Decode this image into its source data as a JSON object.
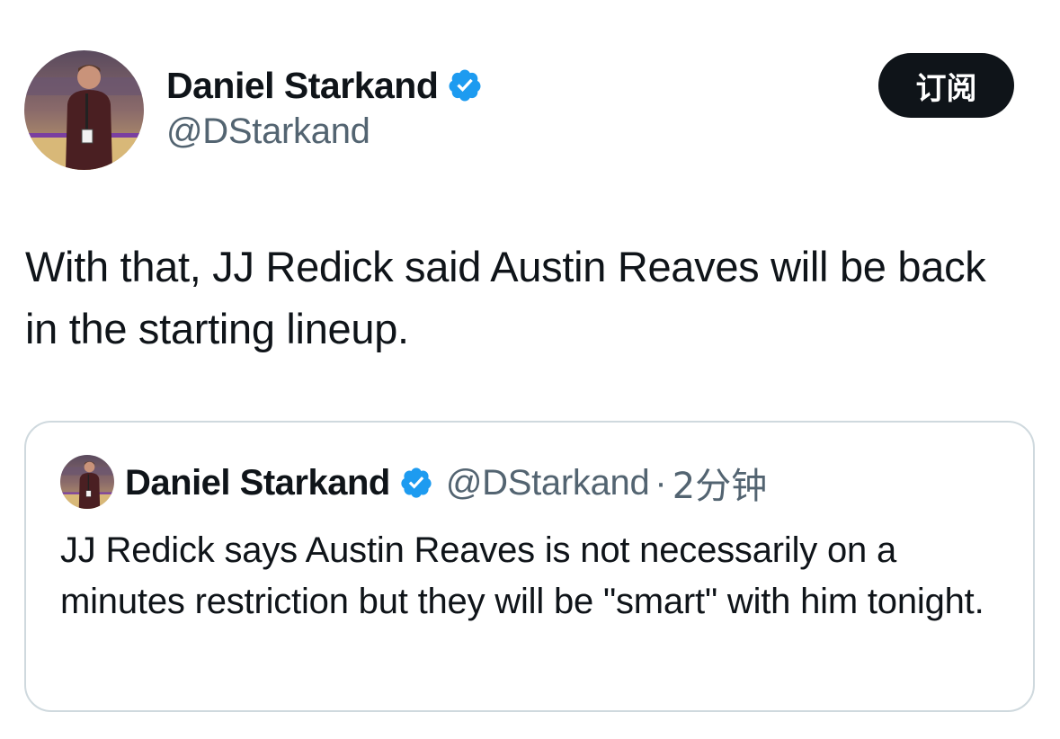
{
  "tweet": {
    "author": {
      "name": "Daniel Starkand",
      "handle": "@DStarkand",
      "verified": true,
      "avatar_icon": "profile-photo"
    },
    "subscribe_label": "订阅",
    "text": "With that, JJ Redick said Austin Reaves will be back in the starting lineup."
  },
  "quoted_tweet": {
    "author": {
      "name": "Daniel Starkand",
      "handle": "@DStarkand",
      "verified": true
    },
    "separator": "·",
    "time": "2分钟",
    "text": "JJ Redick says Austin Reaves is not necessarily on a minutes restriction but they will be \"smart\" with him tonight."
  },
  "colors": {
    "text": "#0f1419",
    "secondary_text": "#536471",
    "verified_blue": "#1d9bf0",
    "button_bg": "#0f1419",
    "card_border": "#cfd9de"
  }
}
